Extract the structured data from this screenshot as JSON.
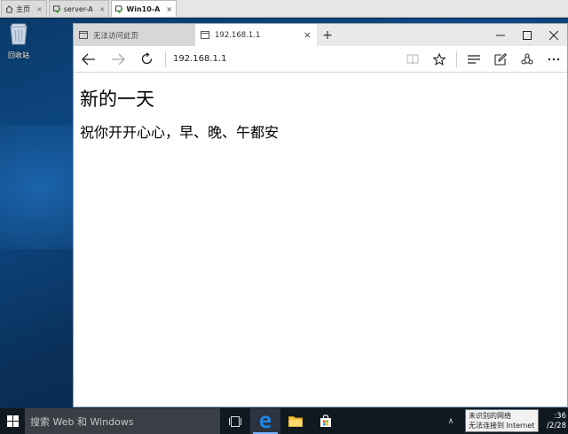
{
  "vm_tabs": [
    {
      "label": "主页",
      "icon": "home-icon"
    },
    {
      "label": "server-A",
      "icon": "vm-icon"
    },
    {
      "label": "Win10-A",
      "icon": "vm-icon",
      "active": true
    }
  ],
  "desktop": {
    "recycle_bin_label": "回收站"
  },
  "browser": {
    "tabs": [
      {
        "title": "无法访问此页",
        "active": false
      },
      {
        "title": "192.168.1.1",
        "active": true
      }
    ],
    "new_tab_symbol": "+",
    "close_symbol": "×",
    "address": "192.168.1.1",
    "page": {
      "heading": "新的一天",
      "body": "祝你开开心心，早、晚、午都安"
    }
  },
  "taskbar": {
    "search_placeholder": "搜索 Web 和 Windows",
    "clock_time": ":36",
    "clock_date": "/2/28"
  },
  "tooltip": {
    "line1": "未识别的网络",
    "line2": "无法连接到 Internet"
  },
  "colors": {
    "edge_accent": "#1e88e5",
    "taskbar": "#101820",
    "desktop": "#0d4a86"
  }
}
